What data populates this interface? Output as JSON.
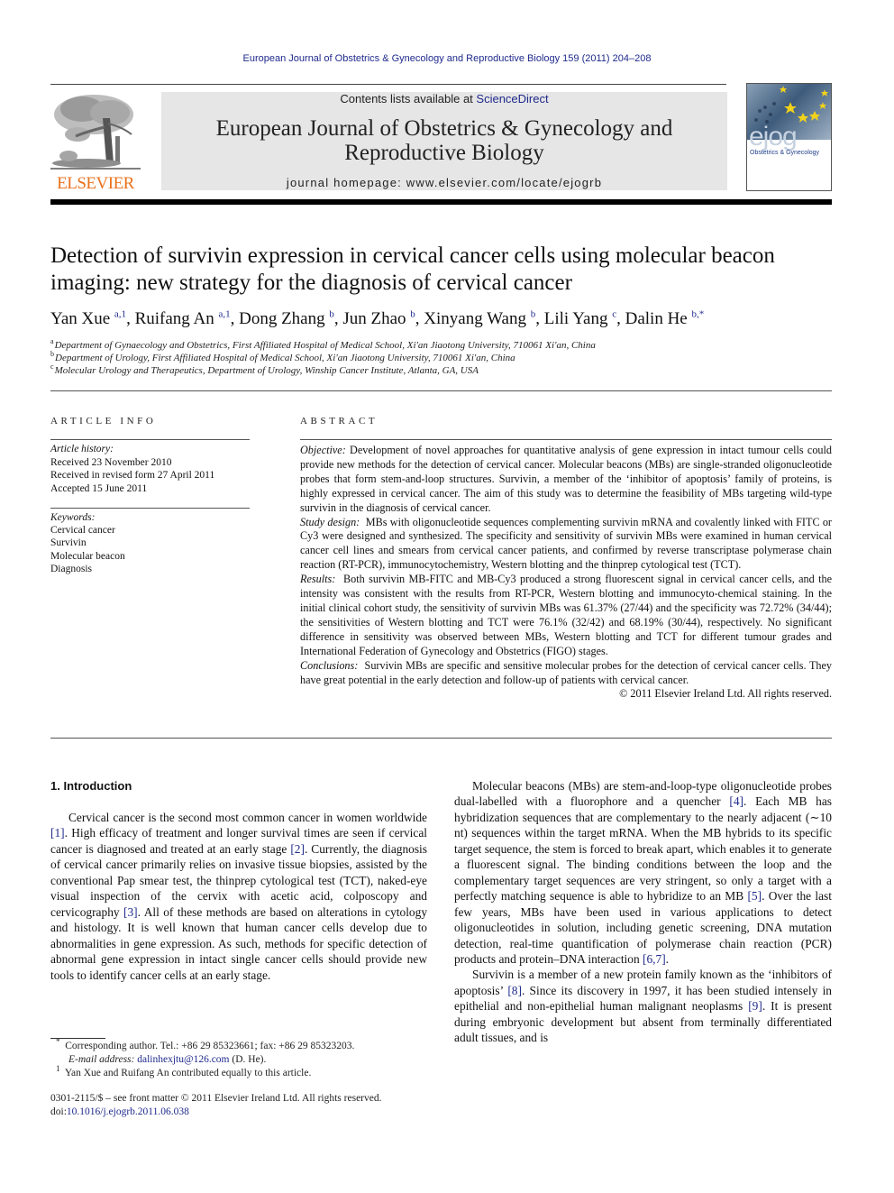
{
  "running_header": "European Journal of Obstetrics & Gynecology and Reproductive Biology 159 (2011) 204–208",
  "masthead": {
    "publisher_logo_text": "ELSEVIER",
    "contents_prefix": "Contents lists available at ",
    "contents_link": "ScienceDirect",
    "journal_title_line1": "European Journal of Obstetrics & Gynecology and",
    "journal_title_line2": "Reproductive Biology",
    "homepage_prefix": "journal homepage: ",
    "homepage_url": "www.elsevier.com/locate/ejogrb",
    "cover_logo": "ejog",
    "cover_subtitle": "Obstetrics & Gynecology",
    "colors": {
      "elsevier_orange": "#e9711c",
      "link_blue": "#1f2a8c",
      "masthead_gray": "#e6e6e6"
    }
  },
  "article": {
    "title": "Detection of survivin expression in cervical cancer cells using molecular beacon imaging: new strategy for the diagnosis of cervical cancer",
    "authors": [
      {
        "name": "Yan Xue",
        "marks": "a,1"
      },
      {
        "name": "Ruifang An",
        "marks": "a,1"
      },
      {
        "name": "Dong Zhang",
        "marks": "b"
      },
      {
        "name": "Jun Zhao",
        "marks": "b"
      },
      {
        "name": "Xinyang Wang",
        "marks": "b"
      },
      {
        "name": "Lili Yang",
        "marks": "c"
      },
      {
        "name": "Dalin He",
        "marks": "b,*"
      }
    ],
    "affiliations": [
      {
        "mark": "a",
        "text": "Department of Gynaecology and Obstetrics, First Affiliated Hospital of Medical School, Xi'an Jiaotong University, 710061 Xi'an, China"
      },
      {
        "mark": "b",
        "text": "Department of Urology, First Affiliated Hospital of Medical School, Xi'an Jiaotong University, 710061 Xi'an, China"
      },
      {
        "mark": "c",
        "text": "Molecular Urology and Therapeutics, Department of Urology, Winship Cancer Institute, Atlanta, GA, USA"
      }
    ]
  },
  "article_info": {
    "heading": "ARTICLE INFO",
    "history_label": "Article history:",
    "history": [
      "Received 23 November 2010",
      "Received in revised form 27 April 2011",
      "Accepted 15 June 2011"
    ],
    "keywords_label": "Keywords:",
    "keywords": [
      "Cervical cancer",
      "Survivin",
      "Molecular beacon",
      "Diagnosis"
    ]
  },
  "abstract": {
    "heading": "ABSTRACT",
    "sections": [
      {
        "label": "Objective:",
        "text": "Development of novel approaches for quantitative analysis of gene expression in intact tumour cells could provide new methods for the detection of cervical cancer. Molecular beacons (MBs) are single-stranded oligonucleotide probes that form stem-and-loop structures. Survivin, a member of the ‘inhibitor of apoptosis’ family of proteins, is highly expressed in cervical cancer. The aim of this study was to determine the feasibility of MBs targeting wild-type survivin in the diagnosis of cervical cancer."
      },
      {
        "label": "Study design:",
        "text": "MBs with oligonucleotide sequences complementing survivin mRNA and covalently linked with FITC or Cy3 were designed and synthesized. The specificity and sensitivity of survivin MBs were examined in human cervical cancer cell lines and smears from cervical cancer patients, and confirmed by reverse transcriptase polymerase chain reaction (RT-PCR), immunocytochemistry, Western blotting and the thinprep cytological test (TCT)."
      },
      {
        "label": "Results:",
        "text": "Both survivin MB-FITC and MB-Cy3 produced a strong fluorescent signal in cervical cancer cells, and the intensity was consistent with the results from RT-PCR, Western blotting and immunocyto-chemical staining. In the initial clinical cohort study, the sensitivity of survivin MBs was 61.37% (27/44) and the specificity was 72.72% (34/44); the sensitivities of Western blotting and TCT were 76.1% (32/42) and 68.19% (30/44), respectively. No significant difference in sensitivity was observed between MBs, Western blotting and TCT for different tumour grades and International Federation of Gynecology and Obstetrics (FIGO) stages."
      },
      {
        "label": "Conclusions:",
        "text": "Survivin MBs are specific and sensitive molecular probes for the detection of cervical cancer cells. They have great potential in the early detection and follow-up of patients with cervical cancer."
      }
    ],
    "copyright": "© 2011 Elsevier Ireland Ltd. All rights reserved."
  },
  "body": {
    "intro_heading": "1.  Introduction",
    "left_paragraphs": [
      [
        {
          "t": "Cervical cancer is the second most common cancer in women worldwide "
        },
        {
          "ref": "[1]"
        },
        {
          "t": ". High efficacy of treatment and longer survival times are seen if cervical cancer is diagnosed and treated at an early stage "
        },
        {
          "ref": "[2]"
        },
        {
          "t": ". Currently, the diagnosis of cervical cancer primarily relies on invasive tissue biopsies, assisted by the conventional Pap smear test, the thinprep cytological test (TCT), naked-eye visual inspection of the cervix with acetic acid, colposcopy and cervicography "
        },
        {
          "ref": "[3]"
        },
        {
          "t": ". All of these methods are based on alterations in cytology and histology. It is well known that human cancer cells develop due to abnormalities in gene expression. As such, methods for specific detection of abnormal gene expression in intact single cancer cells should provide new tools to identify cancer cells at an early stage."
        }
      ]
    ],
    "right_paragraphs": [
      [
        {
          "t": "Molecular beacons (MBs) are stem-and-loop-type oligonucleotide probes dual-labelled with a fluorophore and a quencher "
        },
        {
          "ref": "[4]"
        },
        {
          "t": ". Each MB has hybridization sequences that are complementary to the nearly adjacent (∼10 nt) sequences within the target mRNA. When the MB hybrids to its specific target sequence, the stem is forced to break apart, which enables it to generate a fluorescent signal. The binding conditions between the loop and the complementary target sequences are very stringent, so only a target with a perfectly matching sequence is able to hybridize to an MB "
        },
        {
          "ref": "[5]"
        },
        {
          "t": ". Over the last few years, MBs have been used in various applications to detect oligonucleotides in solution, including genetic screening, DNA mutation detection, real-time quantification of polymerase chain reaction (PCR) products and protein–DNA interaction "
        },
        {
          "ref": "[6,7]"
        },
        {
          "t": "."
        }
      ],
      [
        {
          "t": "Survivin is a member of a new protein family known as the ‘inhibitors of apoptosis’ "
        },
        {
          "ref": "[8]"
        },
        {
          "t": ". Since its discovery in 1997, it has been studied intensely in epithelial and non-epithelial human malignant neoplasms "
        },
        {
          "ref": "[9]"
        },
        {
          "t": ". It is present during embryonic development but absent from terminally differentiated adult tissues, and is"
        }
      ]
    ]
  },
  "footnotes": {
    "corresponding_mark": "*",
    "corresponding_text": "Corresponding author. Tel.: +86 29 85323661; fax: +86 29 85323203.",
    "email_label": "E-mail address:",
    "email": "dalinhexjtu@126.com",
    "email_suffix": " (D. He).",
    "equal_mark": "1",
    "equal_text": "Yan Xue and Ruifang An contributed equally to this article.",
    "front_matter": "0301-2115/$ – see front matter © 2011 Elsevier Ireland Ltd. All rights reserved.",
    "doi_prefix": "doi:",
    "doi": "10.1016/j.ejogrb.2011.06.038"
  }
}
